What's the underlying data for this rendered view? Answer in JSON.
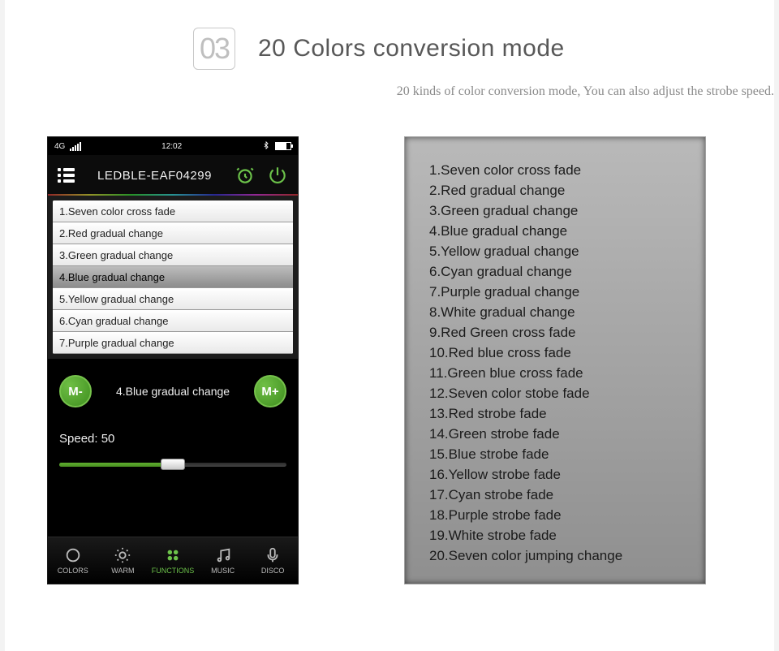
{
  "section": {
    "number": "03",
    "title": "20 Colors conversion mode",
    "subtitle": "20 kinds of color conversion mode, You can also adjust the strobe speed."
  },
  "phone": {
    "status": {
      "network": "4G",
      "time": "12:02"
    },
    "header": {
      "title": "LEDBLE-EAF04299"
    },
    "list": [
      "1.Seven color cross fade",
      "2.Red gradual change",
      "3.Green gradual change",
      "4.Blue gradual change",
      "5.Yellow gradual change",
      "6.Cyan gradual change",
      "7.Purple gradual change"
    ],
    "selected_index": 3,
    "controls": {
      "prev": "M-",
      "next": "M+",
      "current": "4.Blue gradual change"
    },
    "speed": {
      "label": "Speed: 50",
      "value": 50
    },
    "tabs": {
      "items": [
        "COLORS",
        "WARM",
        "FUNCTIONS",
        "MUSIC",
        "DISCO"
      ],
      "active_index": 2
    }
  },
  "modes": [
    "1.Seven color cross fade",
    "2.Red gradual change",
    "3.Green gradual change",
    "4.Blue gradual change",
    "5.Yellow gradual change",
    "6.Cyan gradual change",
    "7.Purple gradual change",
    "8.White gradual change",
    "9.Red Green cross fade",
    "10.Red blue cross fade",
    "11.Green blue cross fade",
    "12.Seven color stobe fade",
    "13.Red strobe fade",
    "14.Green strobe fade",
    "15.Blue strobe fade",
    "16.Yellow strobe fade",
    "17.Cyan strobe fade",
    "18.Purple strobe fade",
    "19.White strobe fade",
    "20.Seven color jumping change"
  ]
}
